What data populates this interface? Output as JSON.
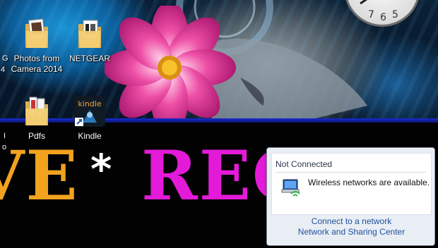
{
  "desktop": {
    "icons": [
      {
        "label_line1": "Photos from",
        "label_line2": "Camera 2014",
        "icon": "folder-icon"
      },
      {
        "label_line1": "NETGEAR",
        "label_line2": "",
        "icon": "folder-icon"
      },
      {
        "label_line1": "Pdfs",
        "label_line2": "",
        "icon": "folder-icon"
      },
      {
        "label_line1": "Kindle",
        "label_line2": "",
        "icon": "kindle-shortcut-icon",
        "app_text": "kindle"
      }
    ],
    "partial_labels": [
      "G",
      "4",
      "I",
      "o"
    ]
  },
  "wallpaper": {
    "left_letters": "VE",
    "asterisk": "*",
    "right_letters": "REC",
    "clock_numbers": [
      "7",
      "6",
      "5"
    ]
  },
  "network_popup": {
    "title": "Not Connected",
    "message": "Wireless networks are available.",
    "links": [
      "Connect to a network",
      "Network and Sharing Center"
    ],
    "icon": "wireless-network-icon"
  },
  "colors": {
    "letters_left": "#f1a21e",
    "letters_right": "#e41ad9",
    "link": "#1e4f9a"
  }
}
